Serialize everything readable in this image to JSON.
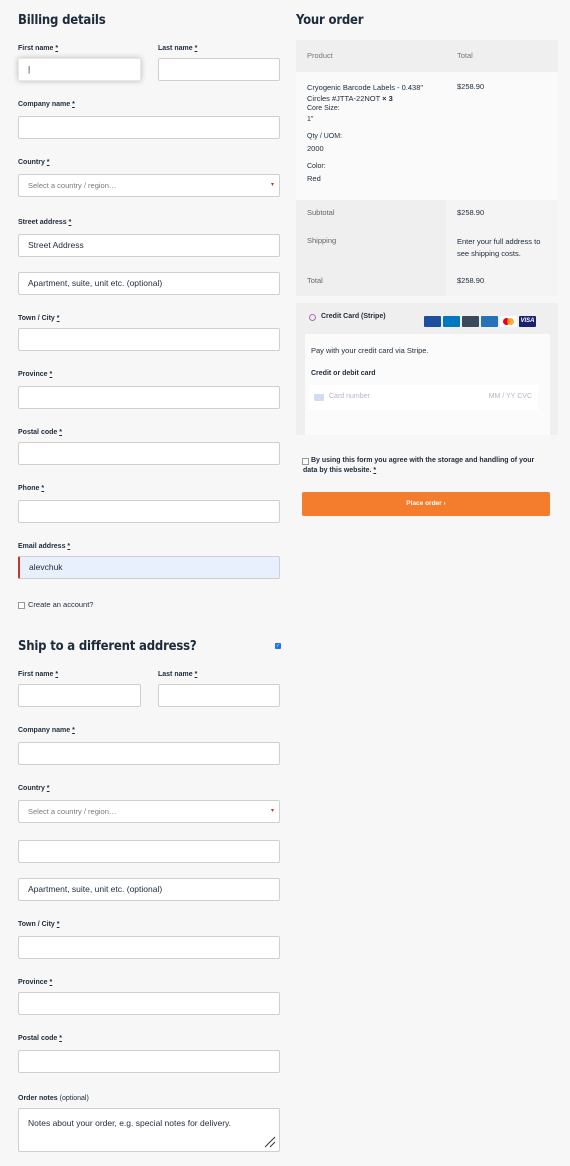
{
  "billing": {
    "title": "Billing details",
    "first_name_label": "First name",
    "last_name_label": "Last name",
    "first_name_value": "|",
    "company_label": "Company name",
    "country_label": "Country",
    "country_placeholder": "Select a country / region…",
    "street_label": "Street address",
    "street_placeholder": "Street Address",
    "apt_placeholder": "Apartment, suite, unit etc. (optional)",
    "city_label": "Town / City",
    "province_label": "Province",
    "postal_label": "Postal code",
    "phone_label": "Phone",
    "email_label": "Email address",
    "email_value": "alevchuk",
    "create_account_label": "Create an account?",
    "required_mark": "*"
  },
  "shipping": {
    "title": "Ship to a different address?",
    "checked": true,
    "first_name_label": "First name",
    "last_name_label": "Last name",
    "company_label": "Company name",
    "country_label": "Country",
    "country_placeholder": "Select a country / region…",
    "apt_placeholder": "Apartment, suite, unit etc. (optional)",
    "city_label": "Town / City",
    "province_label": "Province",
    "postal_label": "Postal code",
    "notes_label": "Order notes",
    "notes_optional": "(optional)",
    "notes_placeholder": "Notes about your order, e.g. special notes for delivery."
  },
  "order": {
    "title": "Your order",
    "col_product": "Product",
    "col_total": "Total",
    "item_name": "Cryogenic Barcode Labels - 0.438\" Circles #JTTA-22NOT",
    "item_qty": "× 3",
    "core_size_label": "Core Size:",
    "core_size_value": "1\"",
    "qty_uom_label": "Qty / UOM:",
    "qty_uom_value": "2000",
    "color_label": "Color:",
    "color_value": "Red",
    "item_total": "$258.90",
    "subtotal_label": "Subtotal",
    "subtotal_value": "$258.90",
    "shipping_label": "Shipping",
    "shipping_value": "Enter your full address to see shipping costs.",
    "total_label": "Total",
    "total_value": "$258.90"
  },
  "payment": {
    "method_label": "Credit Card (Stripe)",
    "description": "Pay with your credit card via Stripe.",
    "card_label": "Credit or debit card",
    "card_number_placeholder": "Card number",
    "card_exp_cvc_placeholder": "MM / YY  CVC",
    "card_brands": [
      "jcb",
      "diners",
      "discover",
      "amex",
      "mastercard",
      "visa"
    ],
    "brand_colors": {
      "jcb": "#1d4fa1",
      "diners": "#0079be",
      "discover": "#3b4a5a",
      "amex": "#2671b9",
      "mastercard": "#333333",
      "visa": "#1a1f71"
    }
  },
  "consent": {
    "text": "By using this form you agree with the storage and handling of your data by this website.",
    "required_mark": "*"
  },
  "place_order": {
    "label": "Place order",
    "arrow": "›",
    "color": "#f47c2d"
  }
}
